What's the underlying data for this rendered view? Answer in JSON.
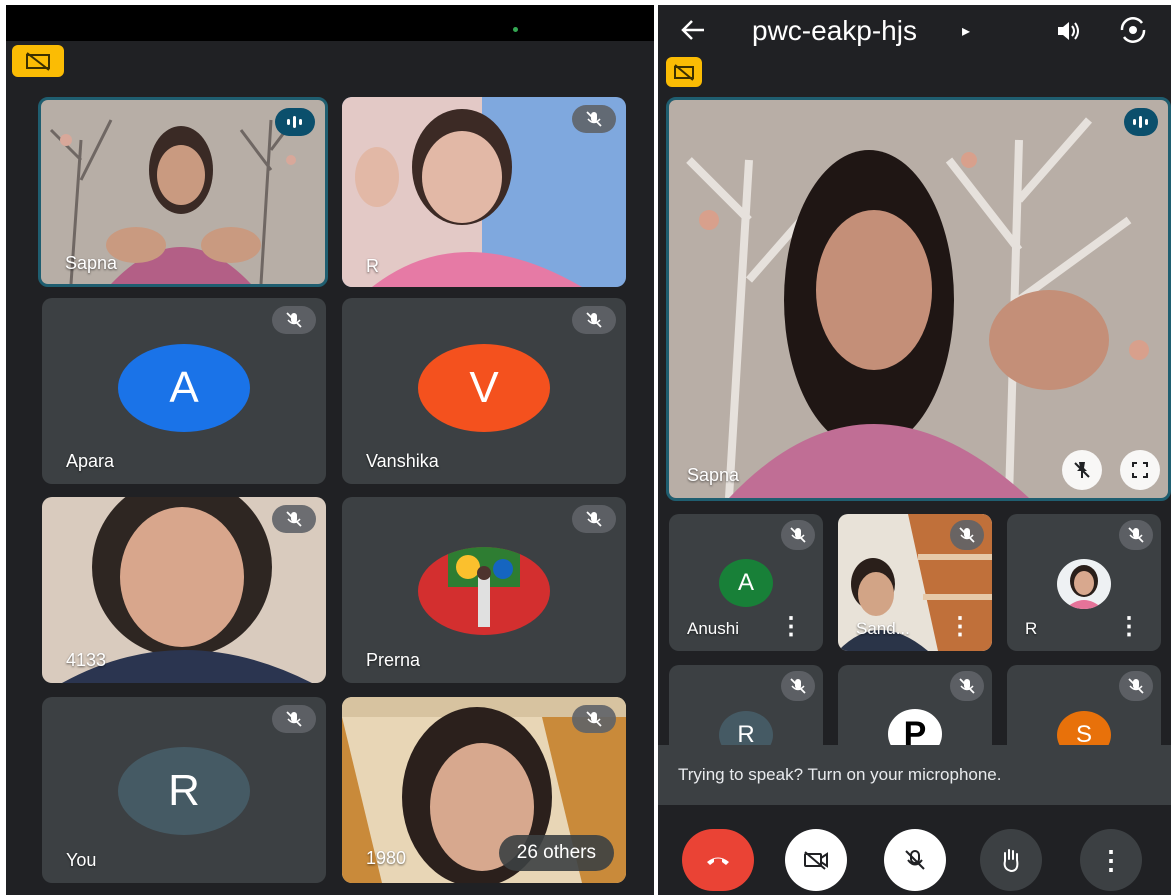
{
  "left": {
    "tiles": [
      {
        "name": "Sapna"
      },
      {
        "name": "R"
      },
      {
        "name": "Apara",
        "initial": "A",
        "color": "#1a73e8"
      },
      {
        "name": "Vanshika",
        "initial": "V",
        "color": "#f4511e"
      },
      {
        "name": "4133"
      },
      {
        "name": "Prerna"
      },
      {
        "name": "You",
        "initial": "R",
        "color": "#455a64"
      },
      {
        "name": "1980",
        "others": "26 others"
      }
    ]
  },
  "right": {
    "meeting_code": "pwc-eakp-hjs",
    "featured": {
      "name": "Sapna"
    },
    "tiles": [
      {
        "name": "Anushi",
        "initial": "A",
        "color": "#188038"
      },
      {
        "name": "Sand..."
      },
      {
        "name": "R"
      },
      {
        "name": "",
        "initial": "R",
        "color": "#455a64"
      },
      {
        "name": "",
        "initial": "P",
        "color": "#ffffff"
      },
      {
        "name": "",
        "initial": "S",
        "color": "#e8710a"
      }
    ],
    "toast": "Trying to speak? Turn on your microphone."
  }
}
